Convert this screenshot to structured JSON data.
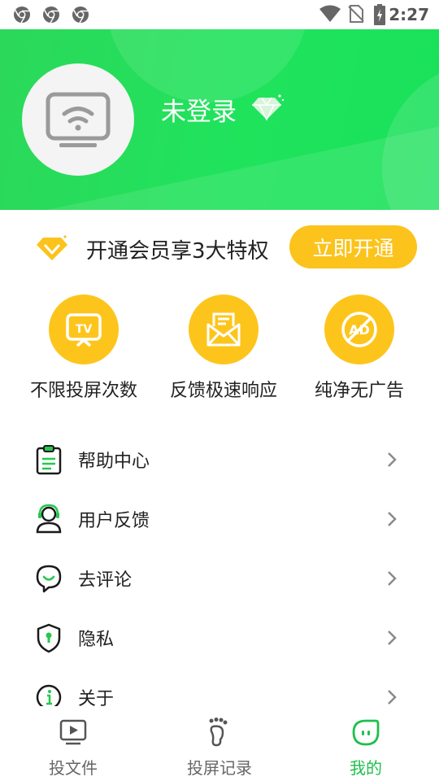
{
  "status_bar": {
    "time": "2:27",
    "left_icons": [
      "chrome-icon",
      "chrome-icon",
      "chrome-icon"
    ],
    "right_icons": [
      "wifi-icon",
      "no-sim-icon",
      "battery-charging-icon"
    ]
  },
  "header": {
    "login_status": "未登录",
    "avatar_icon": "cast-screen-icon",
    "badge_icon": "diamond-icon",
    "gradient_colors": [
      "#2cd85a",
      "#19e15a"
    ]
  },
  "vip": {
    "icon": "vip-diamond-icon",
    "text": "开通会员享3大特权",
    "button_label": "立即开通",
    "accent_color": "#fbc31b"
  },
  "privileges": [
    {
      "icon": "tv-cast-icon",
      "label": "不限投屏次数"
    },
    {
      "icon": "mail-icon",
      "label": "反馈极速响应"
    },
    {
      "icon": "no-ad-icon",
      "label": "纯净无广告"
    }
  ],
  "menu": [
    {
      "icon": "clipboard-icon",
      "label": "帮助中心"
    },
    {
      "icon": "support-agent-icon",
      "label": "用户反馈"
    },
    {
      "icon": "comment-icon",
      "label": "去评论"
    },
    {
      "icon": "shield-lock-icon",
      "label": "隐私"
    },
    {
      "icon": "info-icon",
      "label": "关于"
    }
  ],
  "bottom_nav": {
    "items": [
      {
        "icon": "video-file-icon",
        "label": "投文件",
        "active": false
      },
      {
        "icon": "footprint-icon",
        "label": "投屏记录",
        "active": false
      },
      {
        "icon": "me-icon",
        "label": "我的",
        "active": true
      }
    ],
    "active_color": "#1fbf4c"
  }
}
